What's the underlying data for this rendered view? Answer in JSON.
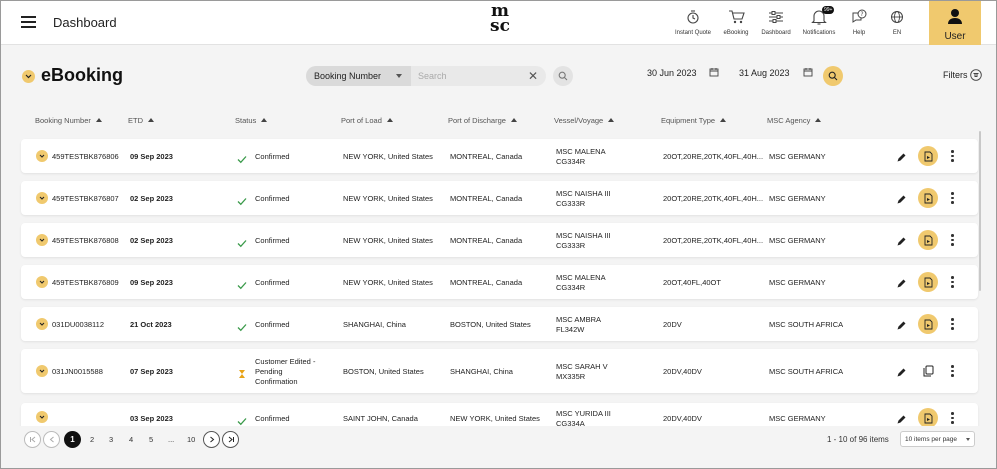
{
  "topbar": {
    "title": "Dashboard",
    "nav": [
      {
        "label": "Instant Quote",
        "icon": "instant-quote-icon"
      },
      {
        "label": "eBooking",
        "icon": "cart-icon"
      },
      {
        "label": "Dashboard",
        "icon": "sliders-icon"
      },
      {
        "label": "Notifications",
        "icon": "bell-icon",
        "badge": "99+"
      },
      {
        "label": "Help",
        "icon": "help-chat-icon"
      },
      {
        "label": "EN",
        "icon": "globe-icon"
      }
    ],
    "user_label": "User"
  },
  "header": {
    "title": "eBooking",
    "search_field": "Booking Number",
    "search_placeholder": "Search",
    "date_from": "30 Jun 2023",
    "date_to": "31 Aug 2023",
    "filters_label": "Filters"
  },
  "columns": [
    "Booking Number",
    "ETD",
    "Status",
    "Port of Load",
    "Port of Discharge",
    "Vessel/Voyage",
    "Equipment Type",
    "MSC Agency"
  ],
  "rows": [
    {
      "booking": "459TESTBK876806",
      "etd": "09 Sep 2023",
      "status": [
        "Confirmed"
      ],
      "status_icon": "check",
      "pol": "NEW YORK, United States",
      "pod": "MONTREAL, Canada",
      "vessel": "MSC MALENA",
      "voyage": "CG334R",
      "equipment": "20OT,20RE,20TK,40FL,40H...",
      "agency": "MSC GERMANY",
      "action": "doc"
    },
    {
      "booking": "459TESTBK876807",
      "etd": "02 Sep 2023",
      "status": [
        "Confirmed"
      ],
      "status_icon": "check",
      "pol": "NEW YORK, United States",
      "pod": "MONTREAL, Canada",
      "vessel": "MSC NAISHA III",
      "voyage": "CG333R",
      "equipment": "20OT,20RE,20TK,40FL,40H...",
      "agency": "MSC GERMANY",
      "action": "doc"
    },
    {
      "booking": "459TESTBK876808",
      "etd": "02 Sep 2023",
      "status": [
        "Confirmed"
      ],
      "status_icon": "check",
      "pol": "NEW YORK, United States",
      "pod": "MONTREAL, Canada",
      "vessel": "MSC NAISHA III",
      "voyage": "CG333R",
      "equipment": "20OT,20RE,20TK,40FL,40H...",
      "agency": "MSC GERMANY",
      "action": "doc"
    },
    {
      "booking": "459TESTBK876809",
      "etd": "09 Sep 2023",
      "status": [
        "Confirmed"
      ],
      "status_icon": "check",
      "pol": "NEW YORK, United States",
      "pod": "MONTREAL, Canada",
      "vessel": "MSC MALENA",
      "voyage": "CG334R",
      "equipment": "20OT,40FL,40OT",
      "agency": "MSC GERMANY",
      "action": "doc"
    },
    {
      "booking": "031DU0038112",
      "etd": "21 Oct 2023",
      "status": [
        "Confirmed"
      ],
      "status_icon": "check",
      "pol": "SHANGHAI, China",
      "pod": "BOSTON, United States",
      "vessel": "MSC AMBRA",
      "voyage": "FL342W",
      "equipment": "20DV",
      "agency": "MSC SOUTH AFRICA",
      "action": "doc"
    },
    {
      "booking": "031JN0015588",
      "etd": "07 Sep 2023",
      "status": [
        "Customer Edited -",
        "Pending",
        "Confirmation"
      ],
      "status_icon": "hourglass",
      "pol": "BOSTON, United States",
      "pod": "SHANGHAI, China",
      "vessel": "MSC SARAH V",
      "voyage": "MX335R",
      "equipment": "20DV,40DV",
      "agency": "MSC SOUTH AFRICA",
      "action": "copy"
    },
    {
      "booking": "",
      "etd": "03 Sep 2023",
      "status": [
        "Confirmed"
      ],
      "status_icon": "check",
      "pol": "SAINT JOHN, Canada",
      "pod": "NEW YORK, United States",
      "vessel": "MSC YURIDA III",
      "voyage": "CG334A",
      "equipment": "20DV,40DV",
      "agency": "MSC GERMANY",
      "action": "doc"
    }
  ],
  "pagination": {
    "active_page": "1",
    "pages": [
      "2",
      "3",
      "4",
      "5",
      "...",
      "10"
    ],
    "range_text": "1 - 10 of 96 items",
    "per_page": "10 items per page"
  },
  "colors": {
    "accent": "#f0c96e",
    "confirmed": "#3a9a4a",
    "pending": "#e8a317"
  }
}
